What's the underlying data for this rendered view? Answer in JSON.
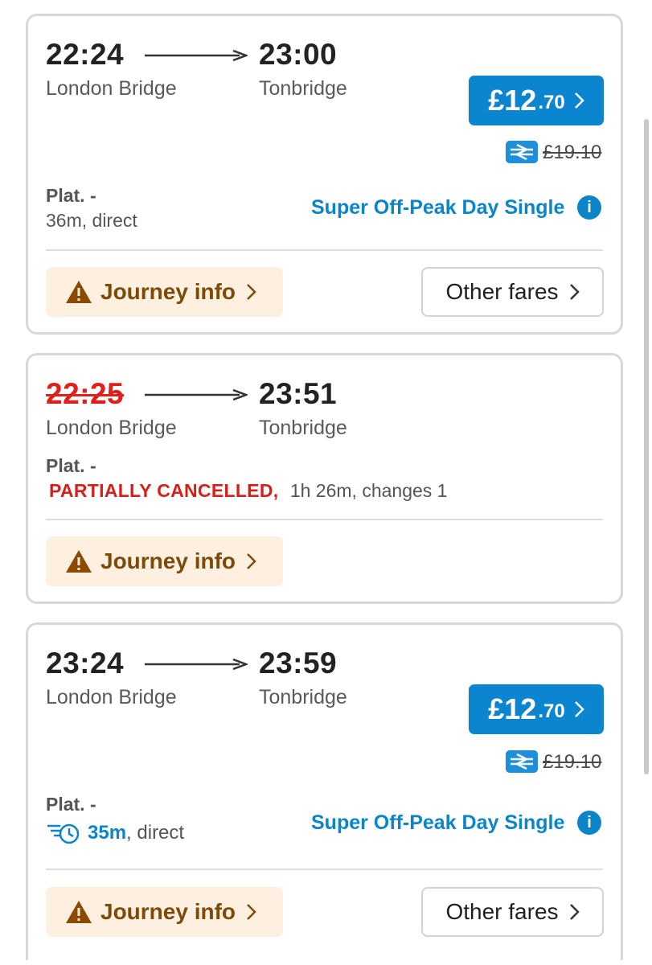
{
  "journeys": [
    {
      "depart": "22:24",
      "arrive": "23:00",
      "from": "London Bridge",
      "to": "Tonbridge",
      "platform": "Plat. -",
      "details": "36m, direct",
      "price_pounds": "£12",
      "price_pence": ".70",
      "original_price": "£19.10",
      "fare_type": "Super Off-Peak Day Single",
      "journey_info_label": "Journey info",
      "other_fares_label": "Other fares"
    },
    {
      "depart": "22:25",
      "arrive": "23:51",
      "from": "London Bridge",
      "to": "Tonbridge",
      "platform": "Plat. -",
      "status": "PARTIALLY CANCELLED,",
      "details": "1h 26m, changes 1",
      "journey_info_label": "Journey info"
    },
    {
      "depart": "23:24",
      "arrive": "23:59",
      "from": "London Bridge",
      "to": "Tonbridge",
      "platform": "Plat. -",
      "fast_duration": "35m",
      "details": ", direct",
      "price_pounds": "£12",
      "price_pence": ".70",
      "original_price": "£19.10",
      "fare_type": "Super Off-Peak Day Single",
      "journey_info_label": "Journey info",
      "other_fares_label": "Other fares"
    }
  ],
  "colors": {
    "accent": "#0b85d0",
    "cancelled": "#e0211b",
    "journey_info_bg": "#fdf0e1",
    "journey_info_text": "#7d4a08",
    "warning": "#8a4b00"
  },
  "icons": [
    "arrow-right-icon",
    "chevron-right-icon",
    "national-rail-icon",
    "info-icon",
    "warning-icon",
    "fast-train-clock-icon"
  ]
}
